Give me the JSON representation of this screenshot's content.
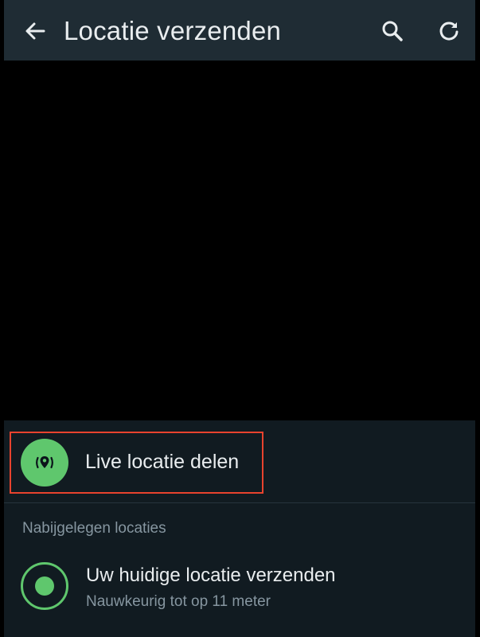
{
  "appbar": {
    "title": "Locatie verzenden",
    "icons": [
      "back-arrow-icon",
      "search-icon",
      "refresh-icon"
    ]
  },
  "live_location": {
    "label": "Live locatie delen",
    "icon": "live-location-icon",
    "highlight_color": "#e8432e"
  },
  "nearby": {
    "header": "Nabijgelegen locaties",
    "current": {
      "title": "Uw huidige locatie verzenden",
      "subtitle": "Nauwkeurig tot op 11 meter",
      "icon": "current-location-icon"
    }
  },
  "colors": {
    "accent": "#5fc76d",
    "appbar_bg": "#1f2c34",
    "sheet_bg": "#111b21",
    "primary_text": "#e9edef",
    "secondary_text": "#8696a0"
  }
}
